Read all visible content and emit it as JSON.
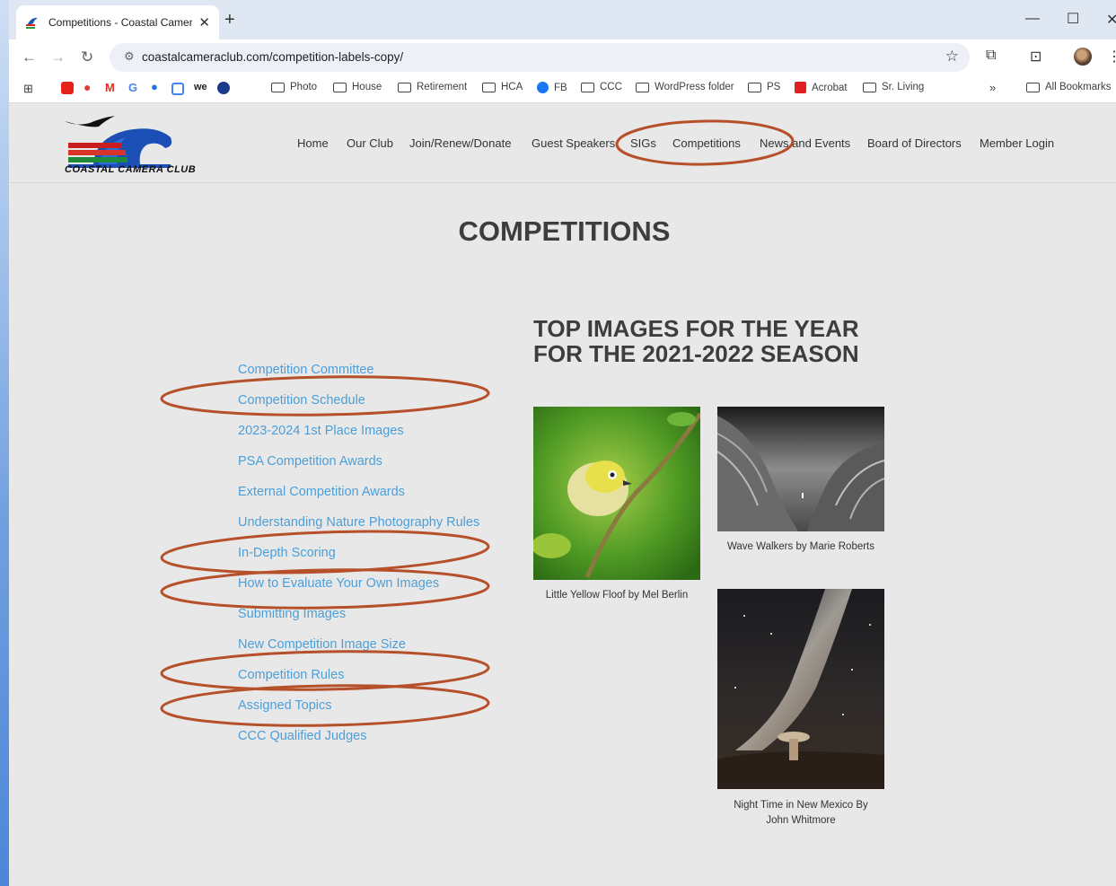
{
  "browser": {
    "tab_title": "Competitions - Coastal Camera",
    "tab_close": "✕",
    "new_tab": "+",
    "url": "coastalcameraclub.com/competition-labels-copy/",
    "bookmarks": [
      "Photo",
      "House",
      "Retirement",
      "HCA",
      "FB",
      "CCC",
      "WordPress folder",
      "PS",
      "Acrobat",
      "Sr. Living"
    ],
    "more_bookmarks": "»",
    "all_bookmarks": "All Bookmarks"
  },
  "site": {
    "logo_text": "COASTAL CAMERA CLUB",
    "menu": [
      "Home",
      "Our Club",
      "Join/Renew/Donate",
      "Guest Speakers",
      "SIGs",
      "Competitions",
      "News and Events",
      "Board of Directors",
      "Member Login"
    ]
  },
  "main": {
    "title": "COMPETITIONS",
    "side_links": [
      "Competition Committee",
      "Competition Schedule",
      "2023-2024 1st Place Images",
      "PSA Competition Awards",
      "External Competition Awards",
      "Understanding Nature Photography Rules",
      "In-Depth Scoring",
      "How to Evaluate Your Own Images",
      "Submitting Images",
      "New Competition Image Size",
      "Competition Rules",
      "Assigned Topics",
      "CCC Qualified Judges"
    ],
    "top_heading_line1": "TOP IMAGES FOR THE YEAR",
    "top_heading_line2": "FOR THE 2021-2022 SEASON",
    "images": [
      {
        "caption": "Little Yellow Floof by Mel Berlin"
      },
      {
        "caption": "Wave Walkers by Marie Roberts"
      },
      {
        "caption_line1": "Night Time in New Mexico By",
        "caption_line2": "John Whitmore"
      }
    ]
  },
  "colors": {
    "link": "#4b9fd9",
    "annotation": "#b5502a"
  }
}
